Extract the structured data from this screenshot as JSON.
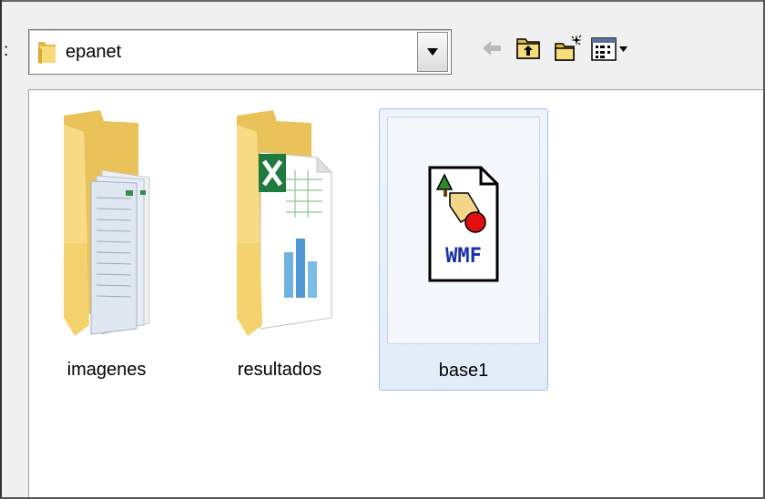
{
  "dialog": {
    "look_in_label": ":",
    "location": {
      "value": "epanet",
      "icon": "folder-icon"
    },
    "toolbar": [
      {
        "name": "back-button",
        "icon": "back-arrow-icon"
      },
      {
        "name": "up-one-level-button",
        "icon": "folder-up-icon"
      },
      {
        "name": "new-folder-button",
        "icon": "new-folder-icon"
      },
      {
        "name": "view-menu-button",
        "icon": "view-menu-icon"
      }
    ]
  },
  "files": [
    {
      "name": "imagenes",
      "type": "folder",
      "icon": "folder-with-images-icon",
      "selected": false
    },
    {
      "name": "resultados",
      "type": "folder",
      "icon": "folder-with-spreadsheet-icon",
      "selected": false
    },
    {
      "name": "base1",
      "type": "file",
      "icon": "wmf-file-icon",
      "badge": "WMF",
      "selected": true
    }
  ],
  "colors": {
    "selection_border": "#9fc2e6",
    "selection_fill": "#e5effb",
    "folder_yellow": "#f4d36e",
    "wmf_text": "#1a2fa8"
  }
}
